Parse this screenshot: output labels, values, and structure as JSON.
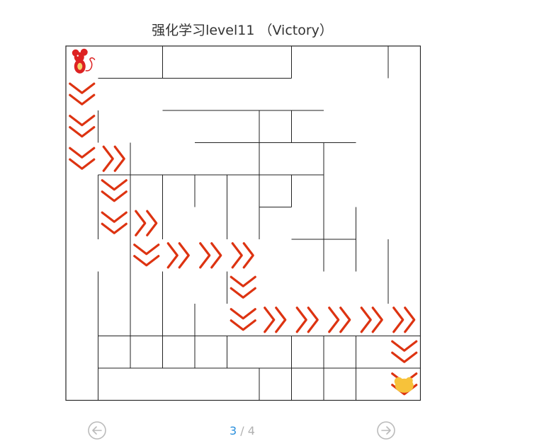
{
  "title": "强化学习level11 （Victory）",
  "pager": {
    "current": "3",
    "separator": " / ",
    "total": "4"
  },
  "icons": {
    "prev": "circle-arrow-left-icon",
    "next": "circle-arrow-right-icon",
    "agent": "mouse-icon",
    "goal": "cheese-icon",
    "path": "chevron-icon"
  },
  "colors": {
    "wall": "#222222",
    "arrow": "#dd3311",
    "goal": "#f7c23a",
    "mouse": "#dd2222",
    "nav": "#bbbbbb",
    "page_current": "#2a8fdc"
  },
  "maze": {
    "cols": 11,
    "rows": 11,
    "h_walls": [
      [
        1,
        1,
        2
      ],
      [
        4,
        1,
        8
      ],
      [
        10,
        1,
        11
      ],
      [
        9,
        1,
        10
      ],
      [
        1,
        2,
        5
      ],
      [
        9,
        2,
        11
      ],
      [
        4,
        3,
        6
      ],
      [
        10,
        3,
        11
      ],
      [
        0,
        5,
        4
      ],
      [
        4,
        7,
        7
      ],
      [
        10,
        6,
        11
      ],
      [
        0,
        6,
        1
      ],
      [
        1,
        7,
        2
      ],
      [
        0,
        8,
        1
      ],
      [
        0,
        9,
        1
      ],
      [
        3,
        9,
        4
      ],
      [
        2,
        8,
        3
      ],
      [
        6,
        9,
        7
      ],
      [
        9,
        9,
        10
      ],
      [
        10,
        10,
        11
      ],
      [
        5,
        7,
        6
      ],
      [
        7,
        8,
        8
      ]
    ],
    "v_walls": [
      [
        3,
        0,
        1
      ],
      [
        7,
        0,
        1
      ],
      [
        10,
        0,
        1
      ],
      [
        6,
        2,
        4
      ],
      [
        7,
        2,
        3
      ],
      [
        1,
        2,
        3
      ],
      [
        2,
        3,
        10
      ],
      [
        3,
        4,
        6
      ],
      [
        4,
        4,
        5
      ],
      [
        5,
        4,
        6
      ],
      [
        6,
        4,
        6
      ],
      [
        7,
        4,
        5
      ],
      [
        8,
        3,
        7
      ],
      [
        9,
        5,
        7
      ],
      [
        10,
        6,
        8
      ],
      [
        1,
        4,
        6
      ],
      [
        3,
        7,
        10
      ],
      [
        4,
        8,
        10
      ],
      [
        2,
        9,
        10
      ],
      [
        5,
        9,
        10
      ],
      [
        6,
        10,
        11
      ],
      [
        7,
        9,
        11
      ],
      [
        8,
        9,
        11
      ],
      [
        9,
        9,
        11
      ],
      [
        1,
        7,
        11
      ],
      [
        5,
        7,
        8
      ],
      [
        8,
        3,
        4
      ]
    ],
    "agent": [
      0,
      0
    ],
    "goal": [
      10,
      10
    ],
    "path": [
      [
        0,
        1,
        "down"
      ],
      [
        0,
        2,
        "down"
      ],
      [
        0,
        3,
        "down"
      ],
      [
        1,
        3,
        "right"
      ],
      [
        1,
        4,
        "down"
      ],
      [
        1,
        5,
        "down"
      ],
      [
        2,
        5,
        "right"
      ],
      [
        2,
        6,
        "down"
      ],
      [
        3,
        6,
        "right"
      ],
      [
        4,
        6,
        "right"
      ],
      [
        5,
        6,
        "right"
      ],
      [
        5,
        7,
        "down"
      ],
      [
        5,
        8,
        "down"
      ],
      [
        6,
        8,
        "right"
      ],
      [
        7,
        8,
        "right"
      ],
      [
        8,
        8,
        "right"
      ],
      [
        9,
        8,
        "right"
      ],
      [
        10,
        8,
        "right"
      ],
      [
        10,
        9,
        "down"
      ],
      [
        10,
        10,
        "down"
      ]
    ]
  }
}
